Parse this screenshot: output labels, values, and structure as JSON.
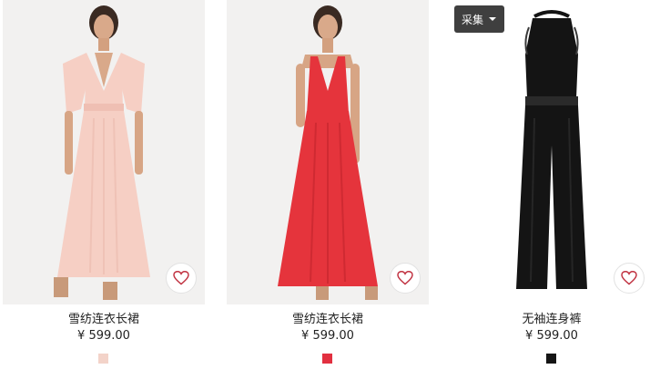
{
  "collect_button": {
    "label": "采集"
  },
  "products": [
    {
      "name": "雪纺连衣长裙",
      "price": "¥ 599.00",
      "swatch_color": "#f3d3c9",
      "dress_color": "#f6cfc4",
      "image_alt": "pink-chiffon-maxi-dress-photo",
      "favorite_icon": "heart-outline-icon"
    },
    {
      "name": "雪纺连衣长裙",
      "price": "¥ 599.00",
      "swatch_color": "#e23040",
      "dress_color": "#e5343c",
      "image_alt": "red-chiffon-maxi-dress-photo",
      "favorite_icon": "heart-outline-icon"
    },
    {
      "name": "无袖连身裤",
      "price": "¥ 599.00",
      "swatch_color": "#151515",
      "dress_color": "#141414",
      "image_alt": "black-sleeveless-jumpsuit-photo",
      "favorite_icon": "heart-outline-icon"
    }
  ],
  "colors": {
    "heart": "#c0303f",
    "card_bg": "#f1f1f1",
    "text": "#222222"
  }
}
